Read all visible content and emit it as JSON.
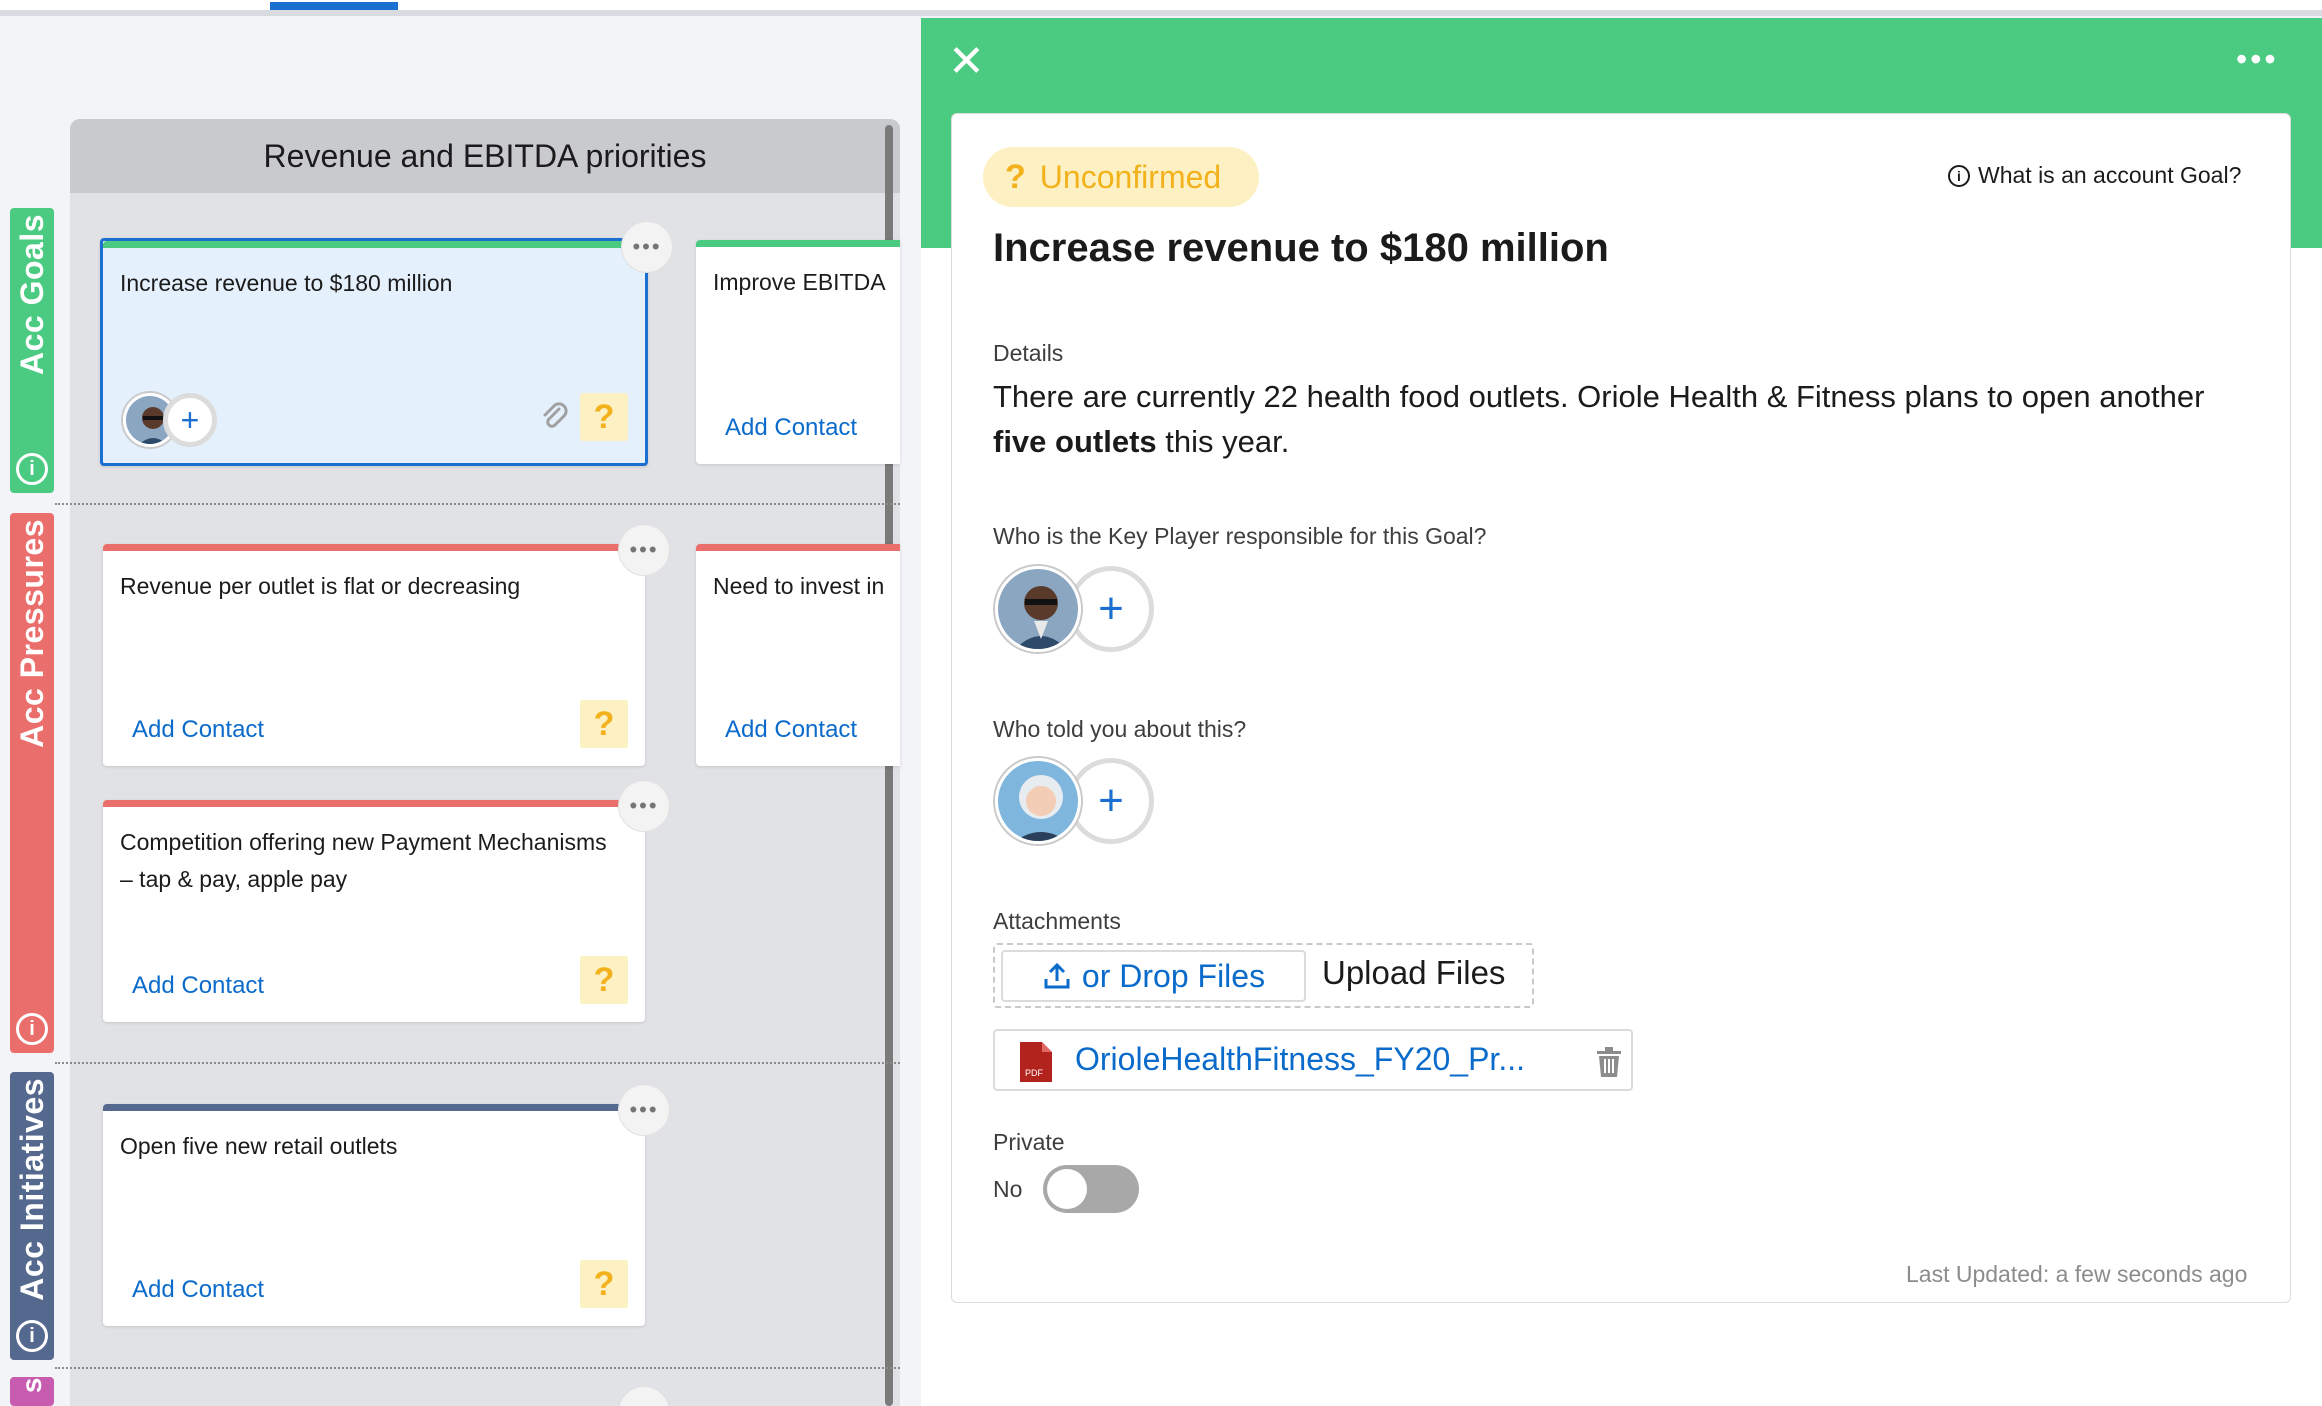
{
  "colors": {
    "goals": "#4bca81",
    "pressures": "#ea6e6b",
    "initiatives": "#54698d",
    "partial_lane": "#c65bb0",
    "accent": "#1b6fd1",
    "warning": "#f3b21c"
  },
  "column": {
    "title": "Revenue and EBITDA priorities"
  },
  "lanes": [
    {
      "label": "Acc Goals",
      "info_icon": "info-icon"
    },
    {
      "label": "Acc Pressures",
      "info_icon": "info-icon"
    },
    {
      "label": "Acc Initiatives",
      "info_icon": "info-icon"
    },
    {
      "label": "s"
    }
  ],
  "cards": [
    {
      "title": "Increase revenue to $180 million",
      "status_icon": "question-icon",
      "attachment_icon": "paperclip-icon",
      "selected": true
    },
    {
      "title": "Improve EBITDA",
      "link": "Add Contact"
    },
    {
      "title": "Revenue per outlet is flat or decreasing",
      "link": "Add Contact",
      "status_icon": "question-icon"
    },
    {
      "title": "Need to invest in",
      "link": "Add Contact"
    },
    {
      "title": "Competition offering new Payment Mechanisms – tap & pay, apple pay",
      "link": "Add Contact",
      "status_icon": "question-icon"
    },
    {
      "title": "Open five new retail outlets",
      "link": "Add Contact",
      "status_icon": "question-icon"
    }
  ],
  "card_more_label": "•••",
  "question_mark": "?",
  "plus": "+",
  "panel": {
    "close_label": "✕",
    "more_label": "•••",
    "status": "Unconfirmed",
    "help_icon_glyph": "i",
    "help_link": "What is an account Goal?",
    "title": "Increase revenue to $180 million",
    "details_label": "Details",
    "details_part1": "There are currently 22 health food outlets. Oriole Health & Fitness plans to open another ",
    "details_bold": "five outlets",
    "details_part2": " this year.",
    "key_player_label": "Who is the Key Player responsible for this Goal?",
    "told_label": "Who told you about this?",
    "attachments_label": "Attachments",
    "upload_button": "or Drop Files",
    "upload_text": "Upload Files",
    "file_name": "OrioleHealthFitness_FY20_Pr...",
    "file_type": "PDF",
    "private_label": "Private",
    "private_value": "No",
    "private_on": false,
    "last_updated": "Last Updated: a few seconds ago"
  }
}
